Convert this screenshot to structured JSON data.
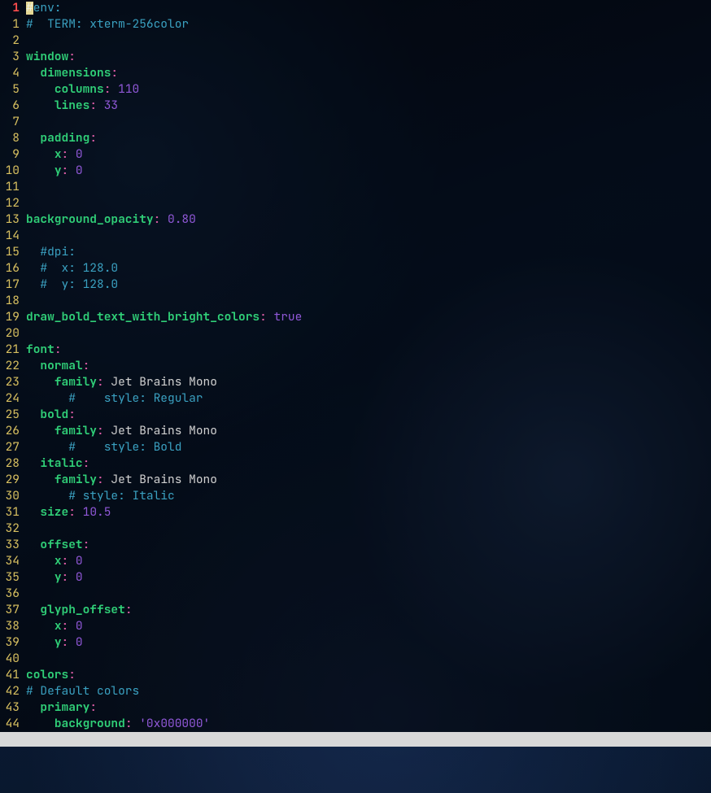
{
  "cursor_line_index": 0,
  "lines": [
    {
      "no": "1",
      "tokens": [
        {
          "cls": "tok-comment",
          "t": "#env:"
        }
      ],
      "has_cursor": true
    },
    {
      "no": "1",
      "tokens": [
        {
          "cls": "tok-comment",
          "t": "#  TERM: xterm-256color"
        }
      ]
    },
    {
      "no": "2",
      "tokens": []
    },
    {
      "no": "3",
      "tokens": [
        {
          "cls": "tok-key",
          "t": "window"
        },
        {
          "cls": "tok-colon",
          "t": ":"
        }
      ]
    },
    {
      "no": "4",
      "tokens": [
        {
          "cls": "tok-plain",
          "t": "  "
        },
        {
          "cls": "tok-key",
          "t": "dimensions"
        },
        {
          "cls": "tok-colon",
          "t": ":"
        }
      ]
    },
    {
      "no": "5",
      "tokens": [
        {
          "cls": "tok-plain",
          "t": "    "
        },
        {
          "cls": "tok-key",
          "t": "columns"
        },
        {
          "cls": "tok-colon",
          "t": ":"
        },
        {
          "cls": "tok-plain",
          "t": " "
        },
        {
          "cls": "tok-num",
          "t": "110"
        }
      ]
    },
    {
      "no": "6",
      "tokens": [
        {
          "cls": "tok-plain",
          "t": "    "
        },
        {
          "cls": "tok-key",
          "t": "lines"
        },
        {
          "cls": "tok-colon",
          "t": ":"
        },
        {
          "cls": "tok-plain",
          "t": " "
        },
        {
          "cls": "tok-num",
          "t": "33"
        }
      ]
    },
    {
      "no": "7",
      "tokens": []
    },
    {
      "no": "8",
      "tokens": [
        {
          "cls": "tok-plain",
          "t": "  "
        },
        {
          "cls": "tok-key",
          "t": "padding"
        },
        {
          "cls": "tok-colon",
          "t": ":"
        }
      ]
    },
    {
      "no": "9",
      "tokens": [
        {
          "cls": "tok-plain",
          "t": "    "
        },
        {
          "cls": "tok-key",
          "t": "x"
        },
        {
          "cls": "tok-colon",
          "t": ":"
        },
        {
          "cls": "tok-plain",
          "t": " "
        },
        {
          "cls": "tok-num",
          "t": "0"
        }
      ]
    },
    {
      "no": "10",
      "tokens": [
        {
          "cls": "tok-plain",
          "t": "    "
        },
        {
          "cls": "tok-key",
          "t": "y"
        },
        {
          "cls": "tok-colon",
          "t": ":"
        },
        {
          "cls": "tok-plain",
          "t": " "
        },
        {
          "cls": "tok-num",
          "t": "0"
        }
      ]
    },
    {
      "no": "11",
      "tokens": []
    },
    {
      "no": "12",
      "tokens": []
    },
    {
      "no": "13",
      "tokens": [
        {
          "cls": "tok-key",
          "t": "background_opacity"
        },
        {
          "cls": "tok-colon",
          "t": ":"
        },
        {
          "cls": "tok-plain",
          "t": " "
        },
        {
          "cls": "tok-num",
          "t": "0.80"
        }
      ]
    },
    {
      "no": "14",
      "tokens": []
    },
    {
      "no": "15",
      "tokens": [
        {
          "cls": "tok-plain",
          "t": "  "
        },
        {
          "cls": "tok-comment",
          "t": "#dpi:"
        }
      ]
    },
    {
      "no": "16",
      "tokens": [
        {
          "cls": "tok-plain",
          "t": "  "
        },
        {
          "cls": "tok-comment",
          "t": "#  x: 128.0"
        }
      ]
    },
    {
      "no": "17",
      "tokens": [
        {
          "cls": "tok-plain",
          "t": "  "
        },
        {
          "cls": "tok-comment",
          "t": "#  y: 128.0"
        }
      ]
    },
    {
      "no": "18",
      "tokens": []
    },
    {
      "no": "19",
      "tokens": [
        {
          "cls": "tok-key",
          "t": "draw_bold_text_with_bright_colors"
        },
        {
          "cls": "tok-colon",
          "t": ":"
        },
        {
          "cls": "tok-plain",
          "t": " "
        },
        {
          "cls": "tok-atom",
          "t": "true"
        }
      ]
    },
    {
      "no": "20",
      "tokens": []
    },
    {
      "no": "21",
      "tokens": [
        {
          "cls": "tok-key",
          "t": "font"
        },
        {
          "cls": "tok-colon",
          "t": ":"
        }
      ]
    },
    {
      "no": "22",
      "tokens": [
        {
          "cls": "tok-plain",
          "t": "  "
        },
        {
          "cls": "tok-key",
          "t": "normal"
        },
        {
          "cls": "tok-colon",
          "t": ":"
        }
      ]
    },
    {
      "no": "23",
      "tokens": [
        {
          "cls": "tok-plain",
          "t": "    "
        },
        {
          "cls": "tok-key",
          "t": "family"
        },
        {
          "cls": "tok-colon",
          "t": ":"
        },
        {
          "cls": "tok-plain",
          "t": " Jet Brains Mono"
        }
      ]
    },
    {
      "no": "24",
      "tokens": [
        {
          "cls": "tok-plain",
          "t": "      "
        },
        {
          "cls": "tok-comment",
          "t": "#    style: Regular"
        }
      ]
    },
    {
      "no": "25",
      "tokens": [
        {
          "cls": "tok-plain",
          "t": "  "
        },
        {
          "cls": "tok-key",
          "t": "bold"
        },
        {
          "cls": "tok-colon",
          "t": ":"
        }
      ]
    },
    {
      "no": "26",
      "tokens": [
        {
          "cls": "tok-plain",
          "t": "    "
        },
        {
          "cls": "tok-key",
          "t": "family"
        },
        {
          "cls": "tok-colon",
          "t": ":"
        },
        {
          "cls": "tok-plain",
          "t": " Jet Brains Mono"
        }
      ]
    },
    {
      "no": "27",
      "tokens": [
        {
          "cls": "tok-plain",
          "t": "      "
        },
        {
          "cls": "tok-comment",
          "t": "#    style: Bold"
        }
      ]
    },
    {
      "no": "28",
      "tokens": [
        {
          "cls": "tok-plain",
          "t": "  "
        },
        {
          "cls": "tok-key",
          "t": "italic"
        },
        {
          "cls": "tok-colon",
          "t": ":"
        }
      ]
    },
    {
      "no": "29",
      "tokens": [
        {
          "cls": "tok-plain",
          "t": "    "
        },
        {
          "cls": "tok-key",
          "t": "family"
        },
        {
          "cls": "tok-colon",
          "t": ":"
        },
        {
          "cls": "tok-plain",
          "t": " Jet Brains Mono"
        }
      ]
    },
    {
      "no": "30",
      "tokens": [
        {
          "cls": "tok-plain",
          "t": "      "
        },
        {
          "cls": "tok-comment",
          "t": "# style: Italic"
        }
      ]
    },
    {
      "no": "31",
      "tokens": [
        {
          "cls": "tok-plain",
          "t": "  "
        },
        {
          "cls": "tok-key",
          "t": "size"
        },
        {
          "cls": "tok-colon",
          "t": ":"
        },
        {
          "cls": "tok-plain",
          "t": " "
        },
        {
          "cls": "tok-num",
          "t": "10.5"
        }
      ]
    },
    {
      "no": "32",
      "tokens": []
    },
    {
      "no": "33",
      "tokens": [
        {
          "cls": "tok-plain",
          "t": "  "
        },
        {
          "cls": "tok-key",
          "t": "offset"
        },
        {
          "cls": "tok-colon",
          "t": ":"
        }
      ]
    },
    {
      "no": "34",
      "tokens": [
        {
          "cls": "tok-plain",
          "t": "    "
        },
        {
          "cls": "tok-key",
          "t": "x"
        },
        {
          "cls": "tok-colon",
          "t": ":"
        },
        {
          "cls": "tok-plain",
          "t": " "
        },
        {
          "cls": "tok-num",
          "t": "0"
        }
      ]
    },
    {
      "no": "35",
      "tokens": [
        {
          "cls": "tok-plain",
          "t": "    "
        },
        {
          "cls": "tok-key",
          "t": "y"
        },
        {
          "cls": "tok-colon",
          "t": ":"
        },
        {
          "cls": "tok-plain",
          "t": " "
        },
        {
          "cls": "tok-num",
          "t": "0"
        }
      ]
    },
    {
      "no": "36",
      "tokens": []
    },
    {
      "no": "37",
      "tokens": [
        {
          "cls": "tok-plain",
          "t": "  "
        },
        {
          "cls": "tok-key",
          "t": "glyph_offset"
        },
        {
          "cls": "tok-colon",
          "t": ":"
        }
      ]
    },
    {
      "no": "38",
      "tokens": [
        {
          "cls": "tok-plain",
          "t": "    "
        },
        {
          "cls": "tok-key",
          "t": "x"
        },
        {
          "cls": "tok-colon",
          "t": ":"
        },
        {
          "cls": "tok-plain",
          "t": " "
        },
        {
          "cls": "tok-num",
          "t": "0"
        }
      ]
    },
    {
      "no": "39",
      "tokens": [
        {
          "cls": "tok-plain",
          "t": "    "
        },
        {
          "cls": "tok-key",
          "t": "y"
        },
        {
          "cls": "tok-colon",
          "t": ":"
        },
        {
          "cls": "tok-plain",
          "t": " "
        },
        {
          "cls": "tok-num",
          "t": "0"
        }
      ]
    },
    {
      "no": "40",
      "tokens": []
    },
    {
      "no": "41",
      "tokens": [
        {
          "cls": "tok-key",
          "t": "colors"
        },
        {
          "cls": "tok-colon",
          "t": ":"
        }
      ]
    },
    {
      "no": "42",
      "tokens": [
        {
          "cls": "tok-comment",
          "t": "# Default colors"
        }
      ]
    },
    {
      "no": "43",
      "tokens": [
        {
          "cls": "tok-plain",
          "t": "  "
        },
        {
          "cls": "tok-key",
          "t": "primary"
        },
        {
          "cls": "tok-colon",
          "t": ":"
        }
      ]
    },
    {
      "no": "44",
      "tokens": [
        {
          "cls": "tok-plain",
          "t": "    "
        },
        {
          "cls": "tok-key",
          "t": "background"
        },
        {
          "cls": "tok-colon",
          "t": ":"
        },
        {
          "cls": "tok-plain",
          "t": " "
        },
        {
          "cls": "tok-str",
          "t": "'0x000000'"
        }
      ]
    }
  ]
}
